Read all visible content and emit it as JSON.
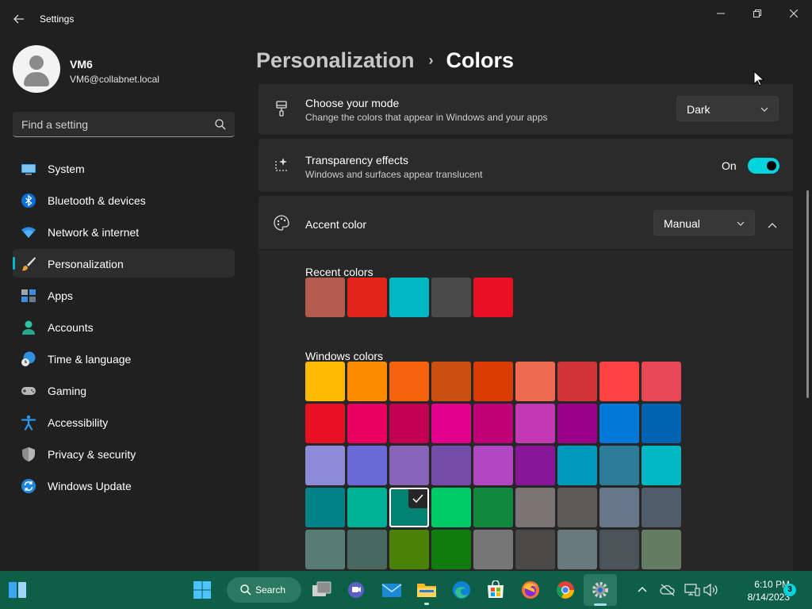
{
  "window": {
    "app_title": "Settings",
    "controls": [
      "minimize",
      "restore",
      "close"
    ]
  },
  "profile": {
    "name": "VM6",
    "email": "VM6@collabnet.local"
  },
  "search": {
    "placeholder": "Find a setting",
    "value": ""
  },
  "sidebar": {
    "active_index": 3,
    "items": [
      {
        "label": "System",
        "icon": "monitor-icon"
      },
      {
        "label": "Bluetooth & devices",
        "icon": "bluetooth-icon"
      },
      {
        "label": "Network & internet",
        "icon": "wifi-icon"
      },
      {
        "label": "Personalization",
        "icon": "brush-icon"
      },
      {
        "label": "Apps",
        "icon": "apps-icon"
      },
      {
        "label": "Accounts",
        "icon": "person-icon"
      },
      {
        "label": "Time & language",
        "icon": "clock-globe-icon"
      },
      {
        "label": "Gaming",
        "icon": "gamepad-icon"
      },
      {
        "label": "Accessibility",
        "icon": "accessibility-icon"
      },
      {
        "label": "Privacy & security",
        "icon": "shield-icon"
      },
      {
        "label": "Windows Update",
        "icon": "update-icon"
      }
    ]
  },
  "breadcrumb": {
    "parent": "Personalization",
    "separator": "›",
    "current": "Colors"
  },
  "mode_card": {
    "title": "Choose your mode",
    "description": "Change the colors that appear in Windows and your apps",
    "selected": "Dark"
  },
  "transparency_card": {
    "title": "Transparency effects",
    "description": "Windows and surfaces appear translucent",
    "state_label": "On",
    "enabled": true
  },
  "accent_card": {
    "title": "Accent color",
    "selected": "Manual",
    "expanded": true,
    "recent_label": "Recent colors",
    "recent_colors": [
      "#b55a4f",
      "#e3241b",
      "#00b7c3",
      "#4a4a4a",
      "#e81123"
    ],
    "windows_label": "Windows colors",
    "selected_color": "#008272",
    "windows_colors": [
      [
        "#ffb900",
        "#ff8c00",
        "#f7630c",
        "#ca5010",
        "#da3b01",
        "#ef6950",
        "#d13438",
        "#ff4343",
        "#e74856"
      ],
      [
        "#e81123",
        "#ea005e",
        "#c30052",
        "#e3008c",
        "#bf0077",
        "#c239b3",
        "#9a0089",
        "#0078d7",
        "#0063b1"
      ],
      [
        "#8e8cd8",
        "#6b69d6",
        "#8764b8",
        "#744da9",
        "#b146c2",
        "#881798",
        "#0099bc",
        "#2d7d9a",
        "#00b7c3"
      ],
      [
        "#038387",
        "#00b294",
        "#008272",
        "#00cc6a",
        "#10893e",
        "#7a7574",
        "#5d5a58",
        "#68768a",
        "#515c6b"
      ],
      [
        "#567c73",
        "#486860",
        "#498205",
        "#107c10",
        "#767676",
        "#4c4a48",
        "#69797e",
        "#4a5459",
        "#647c64"
      ]
    ]
  },
  "taskbar": {
    "search_label": "Search",
    "time": "6:10 PM",
    "date": "8/14/2023",
    "notification_count": "3",
    "background": "#0e5f47"
  },
  "colors": {
    "accent": "#00d4df",
    "window_bg": "#202020",
    "card_bg": "#2b2b2b"
  }
}
